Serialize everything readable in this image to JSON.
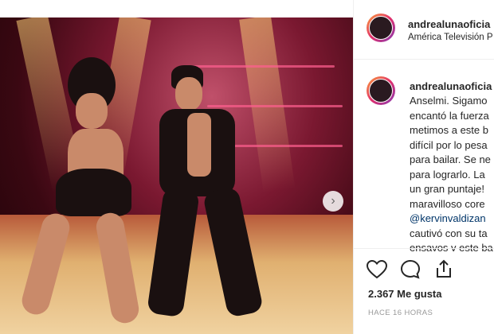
{
  "post": {
    "username": "andrealunaoficia",
    "location": "América Televisión P",
    "caption_lines": [
      "Anselmi. Sigamo",
      "encantó la fuerza",
      "metimos a este b",
      "difícil por lo pesa",
      "para bailar. Se ne",
      "para lograrlo. La",
      "un gran puntaje!",
      "maravilloso core",
      "@kervinvaldizan",
      "cautivó con su ta",
      "ensavos v este ba"
    ],
    "likes": "2.367 Me gusta",
    "time_ago": "HACE 16 HORAS"
  },
  "icons": {
    "like": "heart-icon",
    "comment": "comment-icon",
    "share": "share-icon",
    "next": "chevron-right-icon"
  },
  "colors": {
    "text": "#262626",
    "mention": "#003569",
    "muted": "#999999"
  }
}
